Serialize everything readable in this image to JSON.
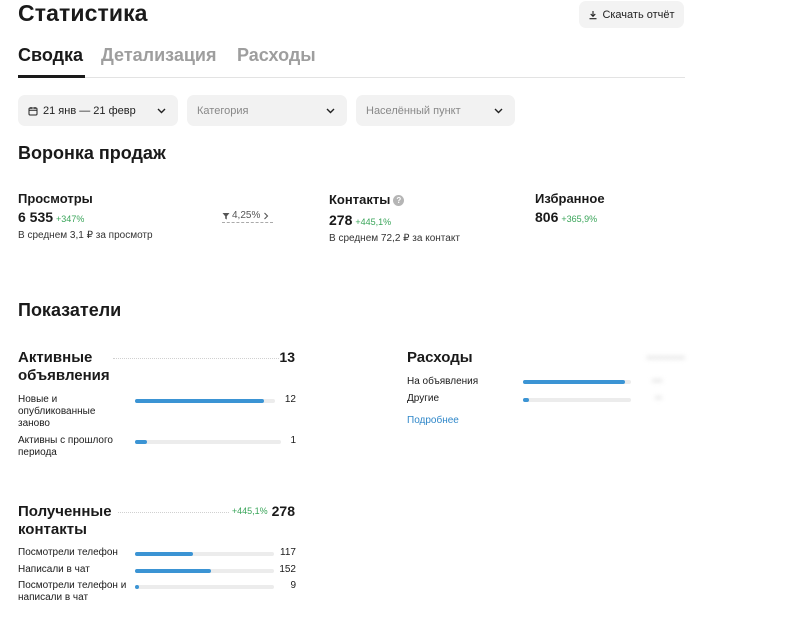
{
  "page": {
    "title": "Статистика",
    "download_button": "Скачать отчёт"
  },
  "tabs": [
    {
      "label": "Сводка",
      "active": true
    },
    {
      "label": "Детализация",
      "active": false
    },
    {
      "label": "Расходы",
      "active": false
    }
  ],
  "filters": {
    "date": "21 янв — 21 февр",
    "category_placeholder": "Категория",
    "city_placeholder": "Населённый пункт"
  },
  "funnel": {
    "title": "Воронка продаж",
    "conversion": "4,25%",
    "metrics": [
      {
        "label": "Просмотры",
        "value": "6 535",
        "change": "+347%",
        "sub": "В среднем 3,1 ₽ за просмотр"
      },
      {
        "label": "Контакты",
        "value": "278",
        "change": "+445,1%",
        "sub": "В среднем 72,2 ₽ за контакт"
      },
      {
        "label": "Избранное",
        "value": "806",
        "change": "+365,9%",
        "sub": ""
      }
    ]
  },
  "indicators": {
    "title": "Показатели",
    "active_listings": {
      "title": "Активные объявления",
      "total": "13",
      "rows": [
        {
          "label": "Новые и опубликованные заново",
          "value": "12",
          "fraction": 0.92
        },
        {
          "label": "Активны с прошлого периода",
          "value": "1",
          "fraction": 0.08
        }
      ]
    },
    "expenses": {
      "title": "Расходы",
      "rows": [
        {
          "label": "На объявления",
          "fraction": 0.94
        },
        {
          "label": "Другие",
          "fraction": 0.06
        }
      ],
      "more_link": "Подробнее"
    },
    "contacts": {
      "title": "Полученные контакты",
      "change": "+445,1%",
      "total": "278",
      "rows": [
        {
          "label": "Посмотрели телефон",
          "value": "117",
          "fraction": 0.42
        },
        {
          "label": "Написали в чат",
          "value": "152",
          "fraction": 0.55
        },
        {
          "label": "Посмотрели телефон и написали в чат",
          "value": "9",
          "fraction": 0.03
        }
      ]
    }
  },
  "colors": {
    "accent": "#3b94d4",
    "positive": "#3aa55a",
    "link": "#2f87c9"
  }
}
